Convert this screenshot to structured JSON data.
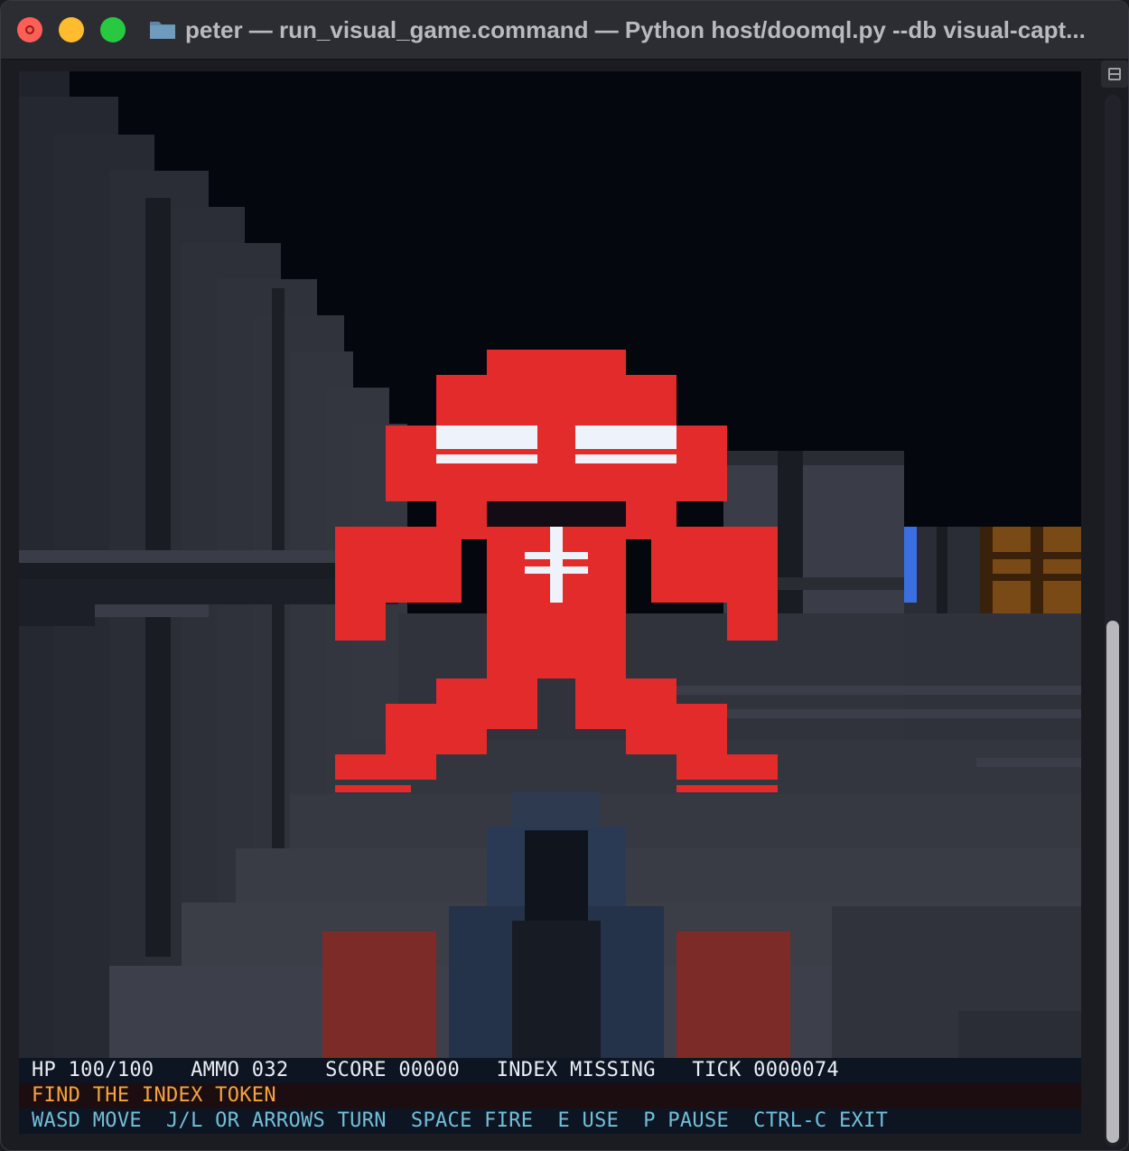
{
  "window": {
    "title": "peter — run_visual_game.command — Python host/doomql.py --db visual-capt..."
  },
  "icons": {
    "folder": "folder-icon",
    "split": "split-view-icon"
  },
  "colors": {
    "enemy": "#e22b2a",
    "eyes": "#eef2fa",
    "sky": "#05070f",
    "wall_dark": "#2a2d35",
    "crate": "#7a4a16",
    "door_blue": "#3a6fe0",
    "hud_message": "#f6a53d",
    "hud_help": "#74bfd8"
  },
  "hud": {
    "status": "HP 100/100   AMMO 032   SCORE 00000   INDEX MISSING   TICK 0000074",
    "message": "FIND THE INDEX TOKEN",
    "help": "WASD MOVE  J/L OR ARROWS TURN  SPACE FIRE  E USE  P PAUSE  CTRL-C EXIT"
  }
}
